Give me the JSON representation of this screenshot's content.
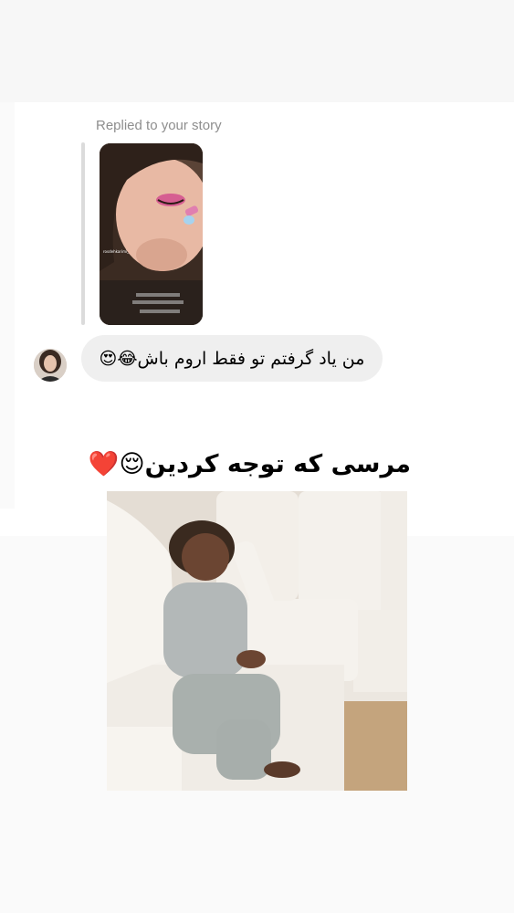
{
  "story_reply": {
    "label": "Replied to your story",
    "story_thumbnail": {
      "watermark": "rosdehkarimi_",
      "overlay_line_1": "اسطا؟ همکاری شیک که صبح",
      "overlay_line_2": "میخابید بیشتر حق هرص میداد",
      "overlay_line_3": "از من آموزش نمیاون بخوامت"
    }
  },
  "message": {
    "text": "من یاد گرفتم تو فقط اروم باش😂😍"
  },
  "post_caption": "مرسی که توجه کردین😌❤️",
  "colors": {
    "page_bg": "#fafafa",
    "card_bg": "#ffffff",
    "bubble_bg": "#efefef",
    "secondary_text": "#8e8e8e",
    "reply_bar": "#dbdbdb"
  }
}
